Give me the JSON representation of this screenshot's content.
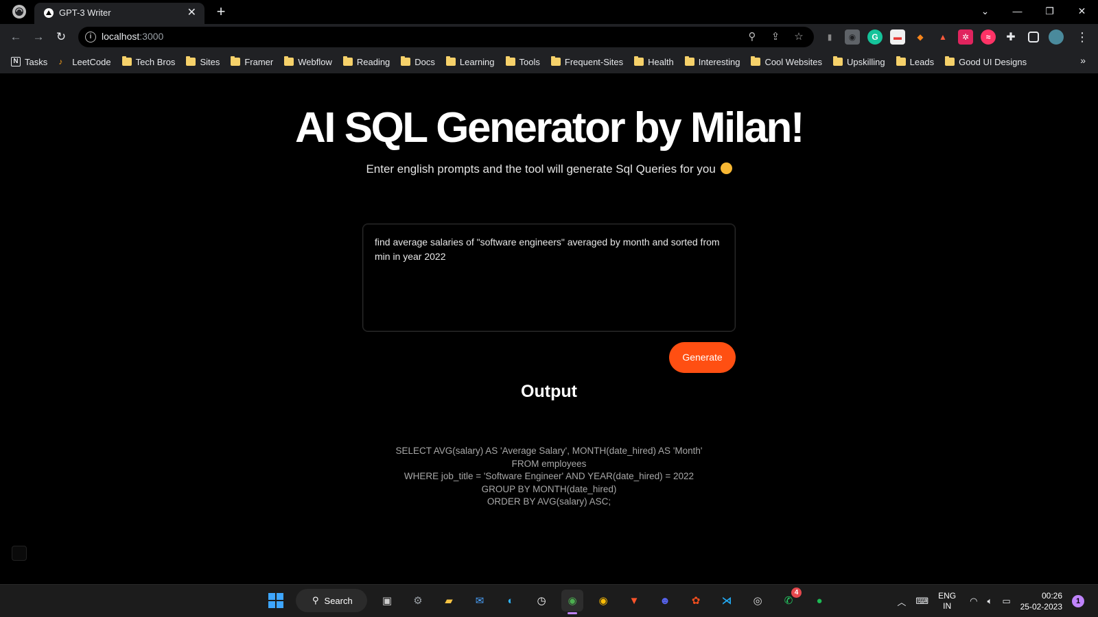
{
  "browser": {
    "tab": {
      "title": "GPT-3 Writer",
      "close": "✕"
    },
    "new_tab": "+",
    "window_controls": {
      "dropdown": "⌄",
      "minimize": "—",
      "restore": "❐",
      "close": "✕"
    },
    "address": {
      "host": "localhost",
      "port": ":3000"
    },
    "bookmarks": [
      {
        "label": "Tasks",
        "icon": "notion-icon"
      },
      {
        "label": "LeetCode",
        "icon": "leetcode-icon"
      },
      {
        "label": "Tech Bros",
        "icon": "folder-icon"
      },
      {
        "label": "Sites",
        "icon": "folder-icon"
      },
      {
        "label": "Framer",
        "icon": "folder-icon"
      },
      {
        "label": "Webflow",
        "icon": "folder-icon"
      },
      {
        "label": "Reading",
        "icon": "folder-icon"
      },
      {
        "label": "Docs",
        "icon": "folder-icon"
      },
      {
        "label": "Learning",
        "icon": "folder-icon"
      },
      {
        "label": "Tools",
        "icon": "folder-icon"
      },
      {
        "label": "Frequent-Sites",
        "icon": "folder-icon"
      },
      {
        "label": "Health",
        "icon": "folder-icon"
      },
      {
        "label": "Interesting",
        "icon": "folder-icon"
      },
      {
        "label": "Cool Websites",
        "icon": "folder-icon"
      },
      {
        "label": "Upskilling",
        "icon": "folder-icon"
      },
      {
        "label": "Leads",
        "icon": "folder-icon"
      },
      {
        "label": "Good UI Designs",
        "icon": "folder-icon"
      }
    ],
    "bookmarks_more": "»"
  },
  "page": {
    "title": "AI SQL Generator by Milan!",
    "subtitle": "Enter english prompts and the tool will generate Sql Queries for you",
    "prompt_value": "find average salaries of \"software engineers\" averaged by month and sorted from min in year 2022",
    "generate_label": "Generate",
    "output_heading": "Output",
    "output_lines": [
      "SELECT AVG(salary) AS 'Average Salary', MONTH(date_hired) AS 'Month'",
      "FROM employees",
      "WHERE job_title = 'Software Engineer' AND YEAR(date_hired) = 2022",
      "GROUP BY MONTH(date_hired)",
      "ORDER BY AVG(salary) ASC;"
    ],
    "accent_color": "#ff4f12"
  },
  "taskbar": {
    "search_label": "Search",
    "whatsapp_badge": "4",
    "language": {
      "line1": "ENG",
      "line2": "IN"
    },
    "time": "00:26",
    "date": "25-02-2023",
    "notification_count": "1"
  }
}
